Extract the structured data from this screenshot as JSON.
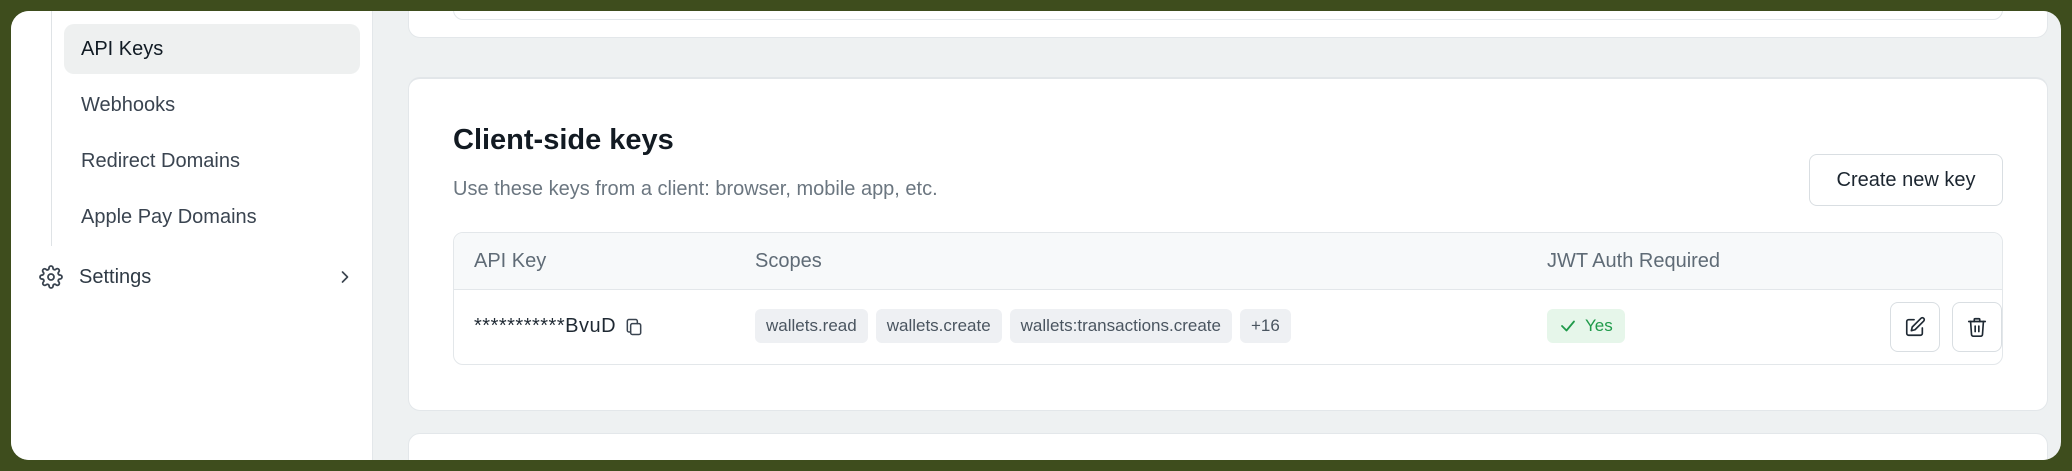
{
  "sidebar": {
    "items": [
      {
        "label": "API Keys",
        "active": true
      },
      {
        "label": "Webhooks",
        "active": false
      },
      {
        "label": "Redirect Domains",
        "active": false
      },
      {
        "label": "Apple Pay Domains",
        "active": false
      }
    ],
    "settings": {
      "label": "Settings",
      "icon": "gear-icon",
      "chevron": "chevron-right-icon"
    }
  },
  "client_keys": {
    "title": "Client-side keys",
    "description": "Use these keys from a client: browser, mobile app, etc.",
    "create_button": "Create new key",
    "columns": [
      "API Key",
      "Scopes",
      "JWT Auth Required"
    ],
    "rows": [
      {
        "api_key": "***********BvuD",
        "scopes": [
          "wallets.read",
          "wallets.create",
          "wallets:transactions.create",
          "+16"
        ],
        "jwt_required": "Yes"
      }
    ]
  },
  "colors": {
    "frame_border": "#3e4d1d",
    "active_nav_bg": "#eef0f0",
    "success_text": "#1f9a4a",
    "success_bg": "#e6f6ea",
    "chip_bg": "#eef0f3"
  }
}
